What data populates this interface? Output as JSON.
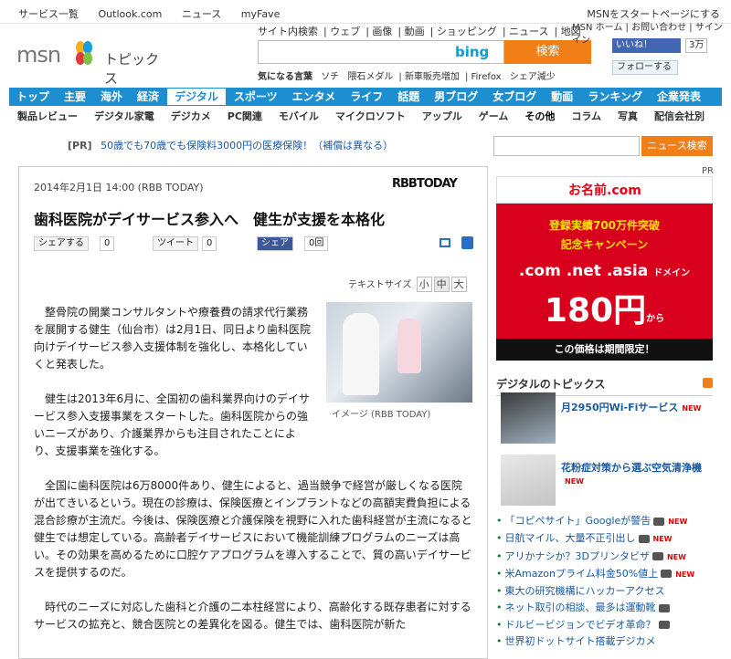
{
  "topbar": {
    "links": [
      "サービス一覧",
      "Outlook.com",
      "ニュース",
      "myFave"
    ],
    "right": "MSNをスタートページにする"
  },
  "logo": {
    "msn": "msn",
    "sub": "トピックス"
  },
  "search": {
    "links": [
      "サイト内検索",
      "ウェブ",
      "画像",
      "動画",
      "ショッピング",
      "ニュース",
      "地図"
    ],
    "engine": "bing",
    "button": "検索"
  },
  "kinews": {
    "label": "気になる言葉",
    "items": [
      "ソチ",
      "隈石メダル",
      "新車販売増加",
      "Firefox",
      "シェア減少"
    ]
  },
  "rightlinks": [
    "MSN ホーム",
    "お問い合わせ",
    "サインイン"
  ],
  "facebook": {
    "label": "いいね！",
    "count": "3万"
  },
  "twitter": {
    "label": "フォローする"
  },
  "nav1": [
    "トップ",
    "主要",
    "海外",
    "経済",
    "デジタル",
    "スポーツ",
    "エンタメ",
    "ライフ",
    "話題",
    "男ブログ",
    "女ブログ",
    "動画",
    "ランキング",
    "企業発表"
  ],
  "nav2": [
    "製品レビュー",
    "デジタル家電",
    "デジカメ",
    "PC関連",
    "モバイル",
    "マイクロソフト",
    "アップル",
    "ゲーム",
    "その他",
    "コラム",
    "写真",
    "配信会社別"
  ],
  "pr": {
    "tag": "[PR]",
    "text": "50歳でも70歳でも保険料3000円の医療保険！（補償は異なる）"
  },
  "newsSearch": {
    "button": "ニュース検索"
  },
  "article": {
    "date": "2014年2月1日 14:00 (RBB TODAY)",
    "source": "RBBTODAY",
    "title": "歯科医院がデイサービス参入へ　健生が支援を本格化",
    "share": {
      "msn": "シェアする",
      "msnCount": "0",
      "tweet": "ツイート",
      "tweetCount": "0",
      "fb": "シェア",
      "fbCount": "0回"
    },
    "textsize": {
      "label": "テキストサイズ",
      "s": "小",
      "m": "中",
      "l": "大"
    },
    "caption": "イメージ (RBB TODAY)",
    "p1": "整骨院の開業コンサルタントや療養費の請求代行業務を展開する健生（仙台市）は2月1日、同日より歯科医院向けデイサービス参入支援体制を強化し、本格化していくと発表した。",
    "p2": "健生は2013年6月に、全国初の歯科業界向けのデイサービス参入支援事業をスタートした。歯科医院からの強いニーズがあり、介護業界からも注目されたことにより、支援事業を強化する。",
    "p3": "全国に歯科医院は6万8000件あり、健生によると、過当競争で経営が厳しくなる医院が出てきいるという。現在の診療は、保険医療とインプラントなどの高額実費負担による混合診療が主流だ。今後は、保険医療と介護保険を視野に入れた歯科経営が主流になると健生では想定している。高齢者デイサービスにおいて機能訓練プログラムのニーズは高い。その効果を高めるために口腔ケアプログラムを導入することで、質の高いデイサービスを提供するのだ。",
    "p4": "時代のニーズに対応した歯科と介護の二本柱経営により、高齢化する既存患者に対するサービスの拡充と、競合医院との差異化を図る。健生では、歯科医院が新た"
  },
  "ad": {
    "pr": "PR",
    "brand": "お名前.com",
    "line1": "登録実績700万件突破",
    "line2": "記念キャンペーン",
    "domains": ".com .net .asia",
    "domainSuffix": "ドメイン",
    "price": "180円",
    "priceSuffix": "から",
    "bottom": "この価格は期間限定！"
  },
  "digital": {
    "heading": "デジタルのトピックス",
    "f1": "月2950円Wi-Fiサービス",
    "f2": "花粉症対策から選ぶ空気清浄機",
    "new": "NEW",
    "list": [
      "「コピペサイト」Googleが警告",
      "日航マイル、大量不正引出し",
      "アリかナシか？3Dプリンタビザ",
      "米Amazonプライム料金50%値上",
      "東大の研究機構にハッカーアクセス",
      "ネット取引の相談、最多は運動靴",
      "ドルビービジョンでビデオ革命？",
      "世界初ドットサイト搭載デジカメ"
    ]
  }
}
